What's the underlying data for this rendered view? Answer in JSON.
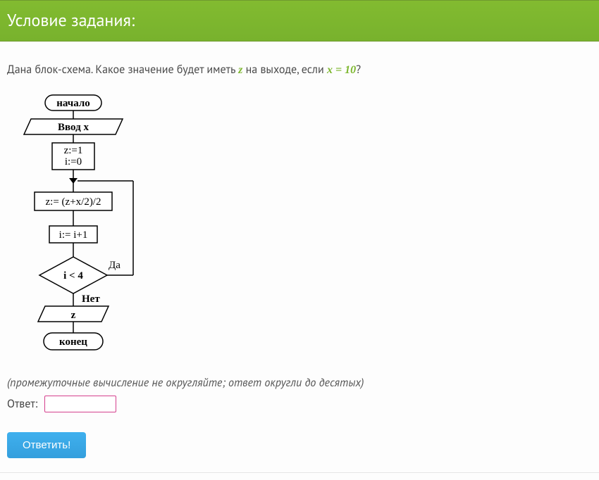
{
  "header": {
    "title": "Условие задания:"
  },
  "prompt": {
    "before_z": "Дана блок-схема. Какое значение будет иметь ",
    "z": "z",
    "mid": " на выходе, если ",
    "eq": "x = 10",
    "after": "?"
  },
  "flowchart": {
    "start": "начало",
    "input": "Ввод  x",
    "init_z": "z:=1",
    "init_i": "i:=0",
    "step_z": "z:= (z+x/2)/2",
    "step_i": "i:= i+1",
    "cond": "i < 4",
    "yes": "Да",
    "no": "Нет",
    "output": "z",
    "end": "конец"
  },
  "hint": "(промежуточные вычисление не округляйте; ответ округли до десятых)",
  "answer": {
    "label": "Ответ:",
    "value": "",
    "placeholder": ""
  },
  "submit": {
    "label": "Ответить!"
  }
}
